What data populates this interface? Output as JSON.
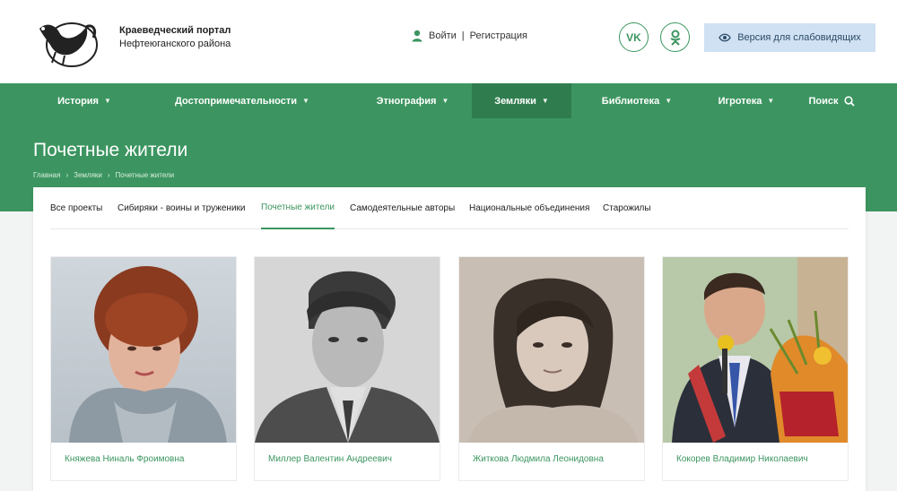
{
  "header": {
    "site_name_line1": "Краеведческий портал",
    "site_name_line2": "Нефтеюганского района",
    "login": "Войти",
    "separator": "|",
    "register": "Регистрация",
    "vk_label": "VK",
    "ok_label": "OK",
    "vision_label": "Версия для слабовидящих"
  },
  "nav": {
    "items": [
      {
        "label": "История"
      },
      {
        "label": "Достопримечательности"
      },
      {
        "label": "Этнография"
      },
      {
        "label": "Земляки"
      },
      {
        "label": "Библиотека"
      },
      {
        "label": "Игротека"
      }
    ],
    "search_label": "Поиск",
    "active": "Земляки"
  },
  "hero": {
    "title": "Почетные жители",
    "breadcrumbs": [
      "Главная",
      "Земляки",
      "Почетные жители"
    ],
    "crumb_sep": "›"
  },
  "tabs": [
    {
      "label": "Все проекты"
    },
    {
      "label": "Сибиряки - воины и труженики"
    },
    {
      "label": "Почетные жители"
    },
    {
      "label": "Самодеятельные авторы"
    },
    {
      "label": "Национальные объединения"
    },
    {
      "label": "Старожилы"
    }
  ],
  "active_tab": "Почетные жители",
  "people": [
    {
      "name": "Княжева Ниналь Фроимовна"
    },
    {
      "name": "Миллер Валентин Андреевич"
    },
    {
      "name": "Житкова Людмила Леонидовна"
    },
    {
      "name": "Кокорев Владимир Николаевич"
    }
  ],
  "colors": {
    "brand_green": "#3c9560",
    "active_nav": "#2f7d4f",
    "vision_button": "#cfe1f3"
  }
}
